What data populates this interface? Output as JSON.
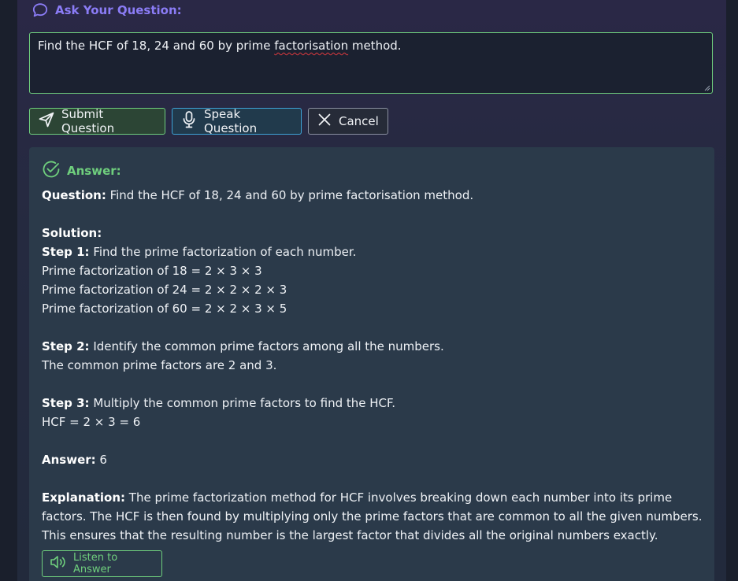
{
  "header": {
    "title": "Ask Your Question:",
    "icon": "chat-bubble-icon",
    "accent": "#8b7cf6"
  },
  "question_input": {
    "value_before": "Find the HCF of 18, 24 and 60 by prime ",
    "value_misspelled": "factorisation",
    "value_after": " method."
  },
  "buttons": {
    "submit": {
      "label": "Submit Question",
      "icon": "send-icon"
    },
    "speak": {
      "label": "Speak Question",
      "icon": "microphone-icon"
    },
    "cancel": {
      "label": "Cancel",
      "icon": "close-icon"
    }
  },
  "answer": {
    "title": "Answer:",
    "icon": "check-circle-icon",
    "question_label": "Question:",
    "question_text": " Find the HCF of 18, 24 and 60 by prime factorisation method.",
    "solution_label": "Solution:",
    "step1_label": "Step 1:",
    "step1_text": " Find the prime factorization of each number.",
    "step1_lines": [
      "Prime factorization of 18 = 2 × 3 × 3",
      "Prime factorization of 24 = 2 × 2 × 2 × 3",
      "Prime factorization of 60 = 2 × 2 × 3 × 5"
    ],
    "step2_label": "Step 2:",
    "step2_text": " Identify the common prime factors among all the numbers.",
    "step2_line": "The common prime factors are 2 and 3.",
    "step3_label": "Step 3:",
    "step3_text": " Multiply the common prime factors to find the HCF.",
    "step3_line": "HCF = 2 × 3 = 6",
    "final_label": "Answer:",
    "final_value": " 6",
    "explanation_label": "Explanation:",
    "explanation_text": " The prime factorization method for HCF involves breaking down each number into its prime factors. The HCF is then found by multiplying only the prime factors that are common to all the given numbers. This ensures that the resulting number is the largest factor that divides all the original numbers exactly.",
    "listen_label": "Listen to Answer",
    "listen_icon": "speaker-icon",
    "accent": "#6fcf7d"
  }
}
